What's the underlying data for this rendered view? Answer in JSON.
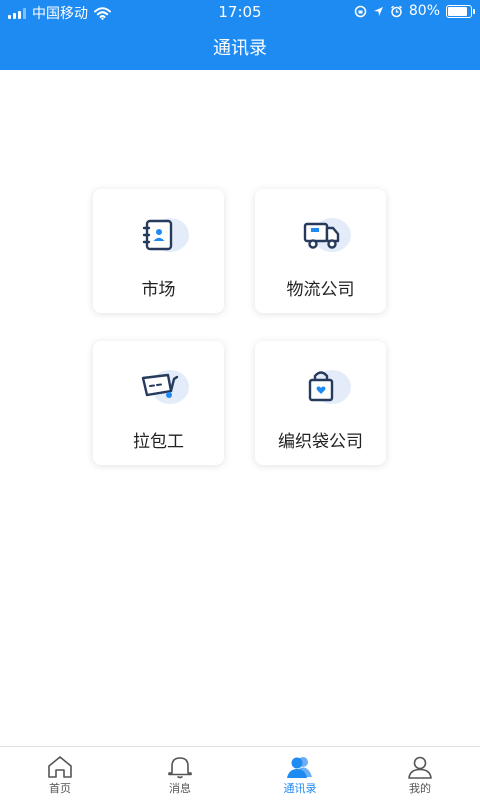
{
  "status_bar": {
    "carrier": "中国移动",
    "time": "17:05",
    "battery": "80%"
  },
  "header": {
    "title": "通讯录"
  },
  "cards": [
    {
      "label": "市场",
      "icon": "contact-book-icon"
    },
    {
      "label": "物流公司",
      "icon": "delivery-truck-icon"
    },
    {
      "label": "拉包工",
      "icon": "hand-cart-icon"
    },
    {
      "label": "编织袋公司",
      "icon": "shopping-bag-icon"
    }
  ],
  "tabbar": {
    "items": [
      {
        "label": "首页",
        "icon": "home-icon"
      },
      {
        "label": "消息",
        "icon": "bell-icon"
      },
      {
        "label": "通讯录",
        "icon": "contacts-icon",
        "active": true
      },
      {
        "label": "我的",
        "icon": "user-icon"
      }
    ]
  },
  "colors": {
    "accent": "#1e8bf3",
    "icon_dark": "#263a5e",
    "icon_bg": "#e3ecf8"
  }
}
